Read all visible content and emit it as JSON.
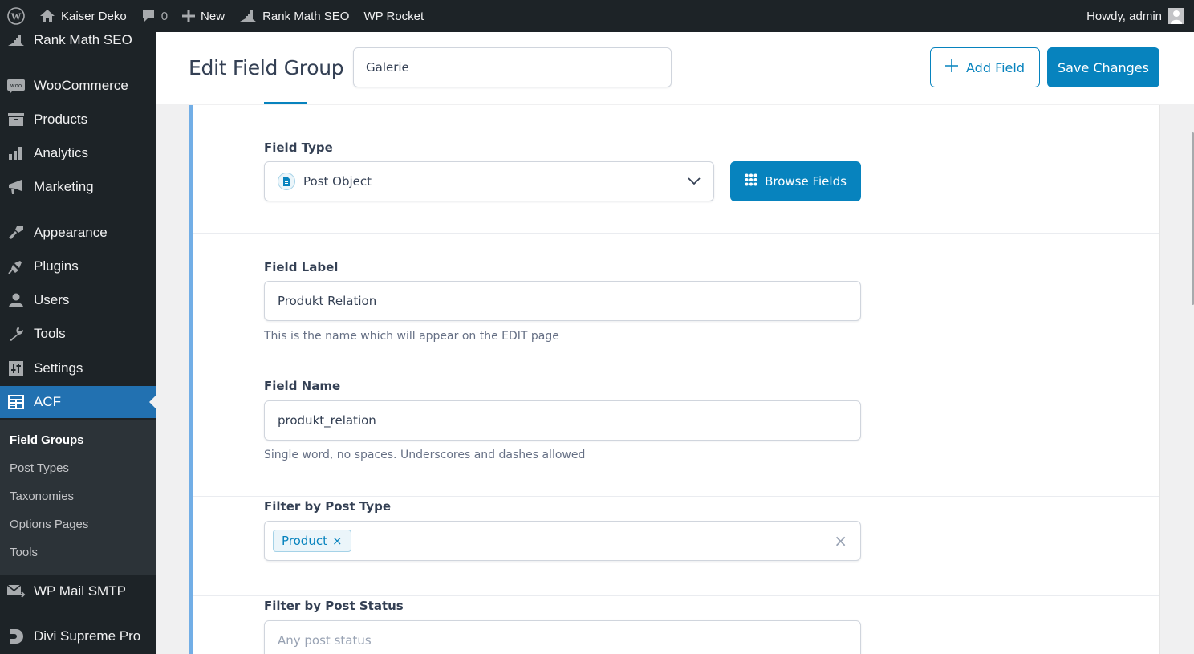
{
  "adminbar": {
    "site_name": "Kaiser Deko",
    "comments_count": "0",
    "new_label": "New",
    "rank_math_label": "Rank Math SEO",
    "wp_rocket_label": "WP Rocket",
    "greeting": "Howdy, admin"
  },
  "sidebar": {
    "items": [
      {
        "label": "Rank Math SEO",
        "icon": "rank-math-icon"
      },
      {
        "label": "WooCommerce",
        "icon": "woo-icon"
      },
      {
        "label": "Products",
        "icon": "archive-icon"
      },
      {
        "label": "Analytics",
        "icon": "bar-chart-icon"
      },
      {
        "label": "Marketing",
        "icon": "megaphone-icon"
      },
      {
        "label": "Appearance",
        "icon": "paintbrush-icon"
      },
      {
        "label": "Plugins",
        "icon": "plug-icon"
      },
      {
        "label": "Users",
        "icon": "user-icon"
      },
      {
        "label": "Tools",
        "icon": "wrench-icon"
      },
      {
        "label": "Settings",
        "icon": "sliders-icon"
      },
      {
        "label": "ACF",
        "icon": "acf-icon",
        "active": true
      },
      {
        "label": "WP Mail SMTP",
        "icon": "mail-icon"
      },
      {
        "label": "Divi Supreme Pro",
        "icon": "divi-icon"
      }
    ],
    "submenu": [
      {
        "label": "Field Groups",
        "current": true
      },
      {
        "label": "Post Types"
      },
      {
        "label": "Taxonomies"
      },
      {
        "label": "Options Pages"
      },
      {
        "label": "Tools"
      }
    ]
  },
  "header": {
    "title": "Edit Field Group",
    "group_title_value": "Galerie",
    "add_field_label": "Add Field",
    "save_label": "Save Changes"
  },
  "field": {
    "type": {
      "label": "Field Type",
      "value": "Post Object",
      "browse_label": "Browse Fields"
    },
    "label": {
      "label": "Field Label",
      "value": "Produkt Relation",
      "help": "This is the name which will appear on the EDIT page"
    },
    "name": {
      "label": "Field Name",
      "value": "produkt_relation",
      "help": "Single word, no spaces. Underscores and dashes allowed"
    },
    "post_type": {
      "label": "Filter by Post Type",
      "tags": [
        "Product"
      ]
    },
    "post_status": {
      "label": "Filter by Post Status",
      "placeholder": "Any post status"
    }
  },
  "colors": {
    "accent": "#0783be",
    "wp_admin_blue": "#2271b1",
    "adminbar_bg": "#1d2327"
  }
}
